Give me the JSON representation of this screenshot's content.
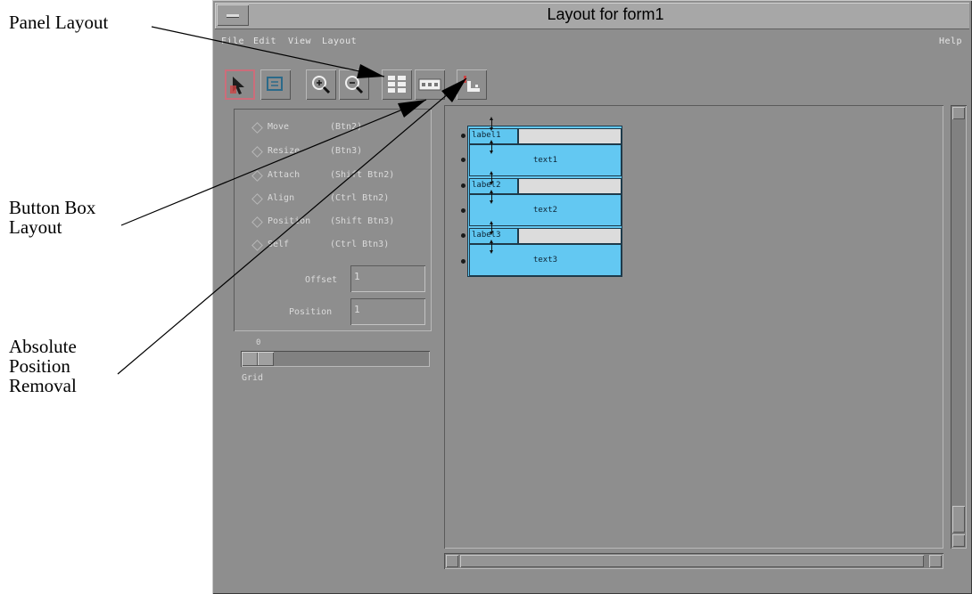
{
  "callouts": {
    "panel_layout": "Panel Layout",
    "button_box_line1": "Button Box",
    "button_box_line2": "Layout",
    "absolute_line1": "Absolute",
    "absolute_line2": "Position",
    "absolute_line3": "Removal"
  },
  "window": {
    "title": "Layout for form1"
  },
  "menubar": {
    "items": [
      "File",
      "Edit",
      "View",
      "Layout"
    ],
    "help": "Help"
  },
  "toolbar": {
    "tools": [
      "select-tool",
      "resize-tool",
      "zoom-in-icon",
      "zoom-out-icon",
      "panel-layout-icon",
      "button-box-layout-icon",
      "absolute-position-removal-icon"
    ]
  },
  "modes": [
    {
      "label": "Move",
      "shortcut": "(Btn2)"
    },
    {
      "label": "Resize",
      "shortcut": "(Btn3)"
    },
    {
      "label": "Attach",
      "shortcut": "(Shift Btn2)"
    },
    {
      "label": "Align",
      "shortcut": "(Ctrl Btn2)"
    },
    {
      "label": "Position",
      "shortcut": "(Shift Btn3)"
    },
    {
      "label": "Self",
      "shortcut": "(Ctrl Btn3)"
    }
  ],
  "fields": {
    "offset_label": "Offset",
    "offset_value": "1",
    "position_label": "Position",
    "position_value": "1"
  },
  "grid": {
    "label": "Grid",
    "value": "0"
  },
  "form": {
    "rows": [
      {
        "label": "label1",
        "text": "text1"
      },
      {
        "label": "label2",
        "text": "text2"
      },
      {
        "label": "label3",
        "text": "text3"
      }
    ]
  },
  "colors": {
    "widget_fill": "#63c8f2",
    "window_bg": "#8e8e8e",
    "selected_tool_border": "#cc6d7a"
  }
}
